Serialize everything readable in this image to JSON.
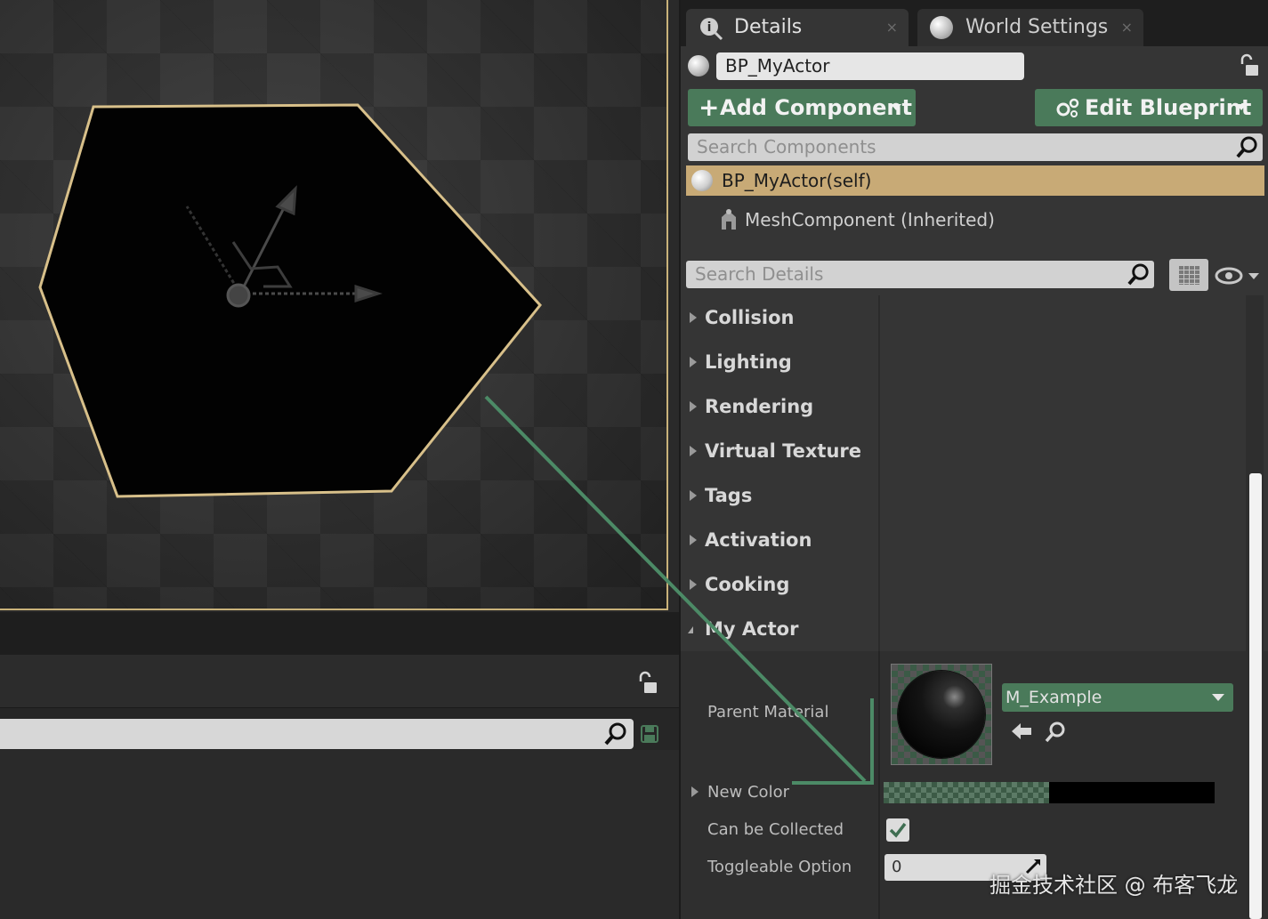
{
  "tabs": [
    {
      "label": "Details",
      "close": "×"
    },
    {
      "label": "World Settings",
      "close": "×"
    }
  ],
  "actor": {
    "name": "BP_MyActor"
  },
  "buttons": {
    "add_component_plus": "+",
    "add_component": "Add Component",
    "edit_blueprint": "Edit Blueprint"
  },
  "components": {
    "search_placeholder": "Search Components",
    "items": [
      {
        "label": "BP_MyActor(self)"
      },
      {
        "label": "MeshComponent (Inherited)"
      }
    ]
  },
  "details": {
    "search_placeholder": "Search Details",
    "categories": [
      {
        "label": "Collision"
      },
      {
        "label": "Lighting"
      },
      {
        "label": "Rendering"
      },
      {
        "label": "Virtual Texture"
      },
      {
        "label": "Tags"
      },
      {
        "label": "Activation"
      },
      {
        "label": "Cooking"
      },
      {
        "label": "My Actor"
      }
    ]
  },
  "my_actor": {
    "parent_material_label": "Parent Material",
    "parent_material_value": "M_Example",
    "new_color_label": "New Color",
    "can_be_collected_label": "Can be Collected",
    "can_be_collected_checked": true,
    "toggleable_option_label": "Toggleable Option",
    "toggleable_option_value": "0"
  },
  "colors": {
    "accent_green": "#4a7a5a",
    "selection_gold": "#c8aa76",
    "annotation_arrow": "#4c8a66"
  },
  "watermark": "掘金技术社区 @ 布客飞龙"
}
